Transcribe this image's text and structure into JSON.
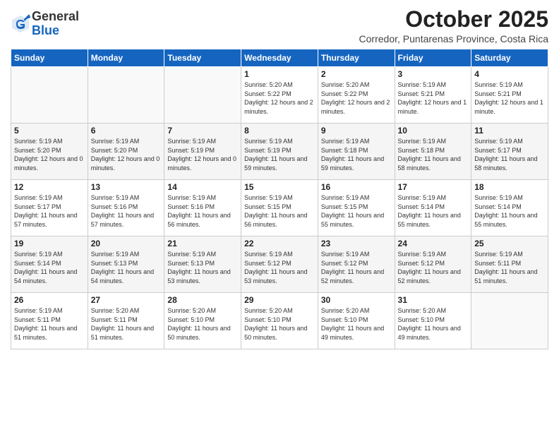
{
  "header": {
    "logo_line1": "General",
    "logo_line2": "Blue",
    "month": "October 2025",
    "location": "Corredor, Puntarenas Province, Costa Rica"
  },
  "weekdays": [
    "Sunday",
    "Monday",
    "Tuesday",
    "Wednesday",
    "Thursday",
    "Friday",
    "Saturday"
  ],
  "weeks": [
    [
      {
        "day": "",
        "sunrise": "",
        "sunset": "",
        "daylight": ""
      },
      {
        "day": "",
        "sunrise": "",
        "sunset": "",
        "daylight": ""
      },
      {
        "day": "",
        "sunrise": "",
        "sunset": "",
        "daylight": ""
      },
      {
        "day": "1",
        "sunrise": "Sunrise: 5:20 AM",
        "sunset": "Sunset: 5:22 PM",
        "daylight": "Daylight: 12 hours and 2 minutes."
      },
      {
        "day": "2",
        "sunrise": "Sunrise: 5:20 AM",
        "sunset": "Sunset: 5:22 PM",
        "daylight": "Daylight: 12 hours and 2 minutes."
      },
      {
        "day": "3",
        "sunrise": "Sunrise: 5:19 AM",
        "sunset": "Sunset: 5:21 PM",
        "daylight": "Daylight: 12 hours and 1 minute."
      },
      {
        "day": "4",
        "sunrise": "Sunrise: 5:19 AM",
        "sunset": "Sunset: 5:21 PM",
        "daylight": "Daylight: 12 hours and 1 minute."
      }
    ],
    [
      {
        "day": "5",
        "sunrise": "Sunrise: 5:19 AM",
        "sunset": "Sunset: 5:20 PM",
        "daylight": "Daylight: 12 hours and 0 minutes."
      },
      {
        "day": "6",
        "sunrise": "Sunrise: 5:19 AM",
        "sunset": "Sunset: 5:20 PM",
        "daylight": "Daylight: 12 hours and 0 minutes."
      },
      {
        "day": "7",
        "sunrise": "Sunrise: 5:19 AM",
        "sunset": "Sunset: 5:19 PM",
        "daylight": "Daylight: 12 hours and 0 minutes."
      },
      {
        "day": "8",
        "sunrise": "Sunrise: 5:19 AM",
        "sunset": "Sunset: 5:19 PM",
        "daylight": "Daylight: 11 hours and 59 minutes."
      },
      {
        "day": "9",
        "sunrise": "Sunrise: 5:19 AM",
        "sunset": "Sunset: 5:18 PM",
        "daylight": "Daylight: 11 hours and 59 minutes."
      },
      {
        "day": "10",
        "sunrise": "Sunrise: 5:19 AM",
        "sunset": "Sunset: 5:18 PM",
        "daylight": "Daylight: 11 hours and 58 minutes."
      },
      {
        "day": "11",
        "sunrise": "Sunrise: 5:19 AM",
        "sunset": "Sunset: 5:17 PM",
        "daylight": "Daylight: 11 hours and 58 minutes."
      }
    ],
    [
      {
        "day": "12",
        "sunrise": "Sunrise: 5:19 AM",
        "sunset": "Sunset: 5:17 PM",
        "daylight": "Daylight: 11 hours and 57 minutes."
      },
      {
        "day": "13",
        "sunrise": "Sunrise: 5:19 AM",
        "sunset": "Sunset: 5:16 PM",
        "daylight": "Daylight: 11 hours and 57 minutes."
      },
      {
        "day": "14",
        "sunrise": "Sunrise: 5:19 AM",
        "sunset": "Sunset: 5:16 PM",
        "daylight": "Daylight: 11 hours and 56 minutes."
      },
      {
        "day": "15",
        "sunrise": "Sunrise: 5:19 AM",
        "sunset": "Sunset: 5:15 PM",
        "daylight": "Daylight: 11 hours and 56 minutes."
      },
      {
        "day": "16",
        "sunrise": "Sunrise: 5:19 AM",
        "sunset": "Sunset: 5:15 PM",
        "daylight": "Daylight: 11 hours and 55 minutes."
      },
      {
        "day": "17",
        "sunrise": "Sunrise: 5:19 AM",
        "sunset": "Sunset: 5:14 PM",
        "daylight": "Daylight: 11 hours and 55 minutes."
      },
      {
        "day": "18",
        "sunrise": "Sunrise: 5:19 AM",
        "sunset": "Sunset: 5:14 PM",
        "daylight": "Daylight: 11 hours and 55 minutes."
      }
    ],
    [
      {
        "day": "19",
        "sunrise": "Sunrise: 5:19 AM",
        "sunset": "Sunset: 5:14 PM",
        "daylight": "Daylight: 11 hours and 54 minutes."
      },
      {
        "day": "20",
        "sunrise": "Sunrise: 5:19 AM",
        "sunset": "Sunset: 5:13 PM",
        "daylight": "Daylight: 11 hours and 54 minutes."
      },
      {
        "day": "21",
        "sunrise": "Sunrise: 5:19 AM",
        "sunset": "Sunset: 5:13 PM",
        "daylight": "Daylight: 11 hours and 53 minutes."
      },
      {
        "day": "22",
        "sunrise": "Sunrise: 5:19 AM",
        "sunset": "Sunset: 5:12 PM",
        "daylight": "Daylight: 11 hours and 53 minutes."
      },
      {
        "day": "23",
        "sunrise": "Sunrise: 5:19 AM",
        "sunset": "Sunset: 5:12 PM",
        "daylight": "Daylight: 11 hours and 52 minutes."
      },
      {
        "day": "24",
        "sunrise": "Sunrise: 5:19 AM",
        "sunset": "Sunset: 5:12 PM",
        "daylight": "Daylight: 11 hours and 52 minutes."
      },
      {
        "day": "25",
        "sunrise": "Sunrise: 5:19 AM",
        "sunset": "Sunset: 5:11 PM",
        "daylight": "Daylight: 11 hours and 51 minutes."
      }
    ],
    [
      {
        "day": "26",
        "sunrise": "Sunrise: 5:19 AM",
        "sunset": "Sunset: 5:11 PM",
        "daylight": "Daylight: 11 hours and 51 minutes."
      },
      {
        "day": "27",
        "sunrise": "Sunrise: 5:20 AM",
        "sunset": "Sunset: 5:11 PM",
        "daylight": "Daylight: 11 hours and 51 minutes."
      },
      {
        "day": "28",
        "sunrise": "Sunrise: 5:20 AM",
        "sunset": "Sunset: 5:10 PM",
        "daylight": "Daylight: 11 hours and 50 minutes."
      },
      {
        "day": "29",
        "sunrise": "Sunrise: 5:20 AM",
        "sunset": "Sunset: 5:10 PM",
        "daylight": "Daylight: 11 hours and 50 minutes."
      },
      {
        "day": "30",
        "sunrise": "Sunrise: 5:20 AM",
        "sunset": "Sunset: 5:10 PM",
        "daylight": "Daylight: 11 hours and 49 minutes."
      },
      {
        "day": "31",
        "sunrise": "Sunrise: 5:20 AM",
        "sunset": "Sunset: 5:10 PM",
        "daylight": "Daylight: 11 hours and 49 minutes."
      },
      {
        "day": "",
        "sunrise": "",
        "sunset": "",
        "daylight": ""
      }
    ]
  ]
}
